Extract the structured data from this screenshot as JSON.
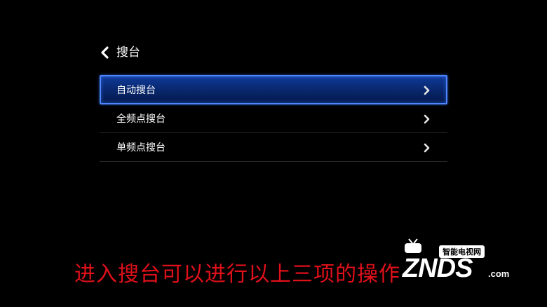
{
  "header": {
    "back_icon": "chevron-left-icon",
    "title": "搜台"
  },
  "menu": {
    "items": [
      {
        "label": "自动搜台",
        "selected": true,
        "icon": "chevron-right-icon"
      },
      {
        "label": "全频点搜台",
        "selected": false,
        "icon": "chevron-right-icon"
      },
      {
        "label": "单频点搜台",
        "selected": false,
        "icon": "chevron-right-icon"
      }
    ]
  },
  "caption": {
    "text": "进入搜台可以进行以上三项的操作",
    "color": "#e0101a"
  },
  "watermark": {
    "small_text": "智能电视网",
    "brand": "ZNDS",
    "suffix": ".com",
    "icon": "tv-icon"
  },
  "colors": {
    "background": "#000000",
    "selection_border": "#4d86ff",
    "selection_fill": "#0a2e7e"
  }
}
